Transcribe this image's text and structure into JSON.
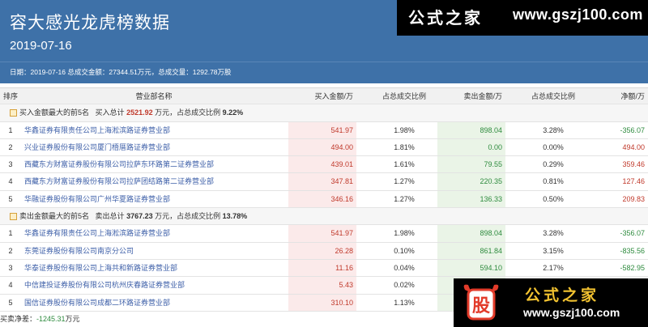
{
  "header": {
    "title": "容大感光龙虎榜数据",
    "date": "2019-07-16",
    "summary": "日期：2019-07-16 总成交金额：27344.51万元，总成交量：1292.78万股"
  },
  "logo": {
    "cn": "公式之家",
    "url": "www.gszj100.com"
  },
  "columns": [
    "排序",
    "营业部名称",
    "买入金额/万",
    "占总成交比例",
    "卖出金额/万",
    "占总成交比例",
    "净额/万"
  ],
  "buy_section": {
    "prefix": "买入金额最大的前5名",
    "total_label": "买入总计",
    "total": "2521.92",
    "unit_text": "万元，占总成交比例",
    "ratio": "9.22%",
    "rows": [
      {
        "rank": "1",
        "name": "华鑫证券有限责任公司上海淞滨路证券营业部",
        "buy": "541.97",
        "buy_pct": "1.98%",
        "sell": "898.04",
        "sell_pct": "3.28%",
        "net": "-356.07",
        "net_sign": "neg"
      },
      {
        "rank": "2",
        "name": "兴业证券股份有限公司厦门梧厝路证券营业部",
        "buy": "494.00",
        "buy_pct": "1.81%",
        "sell": "0.00",
        "sell_pct": "0.00%",
        "net": "494.00",
        "net_sign": "pos"
      },
      {
        "rank": "3",
        "name": "西藏东方财富证券股份有限公司拉萨东环路第二证券营业部",
        "buy": "439.01",
        "buy_pct": "1.61%",
        "sell": "79.55",
        "sell_pct": "0.29%",
        "net": "359.46",
        "net_sign": "pos"
      },
      {
        "rank": "4",
        "name": "西藏东方财富证券股份有限公司拉萨团结路第二证券营业部",
        "buy": "347.81",
        "buy_pct": "1.27%",
        "sell": "220.35",
        "sell_pct": "0.81%",
        "net": "127.46",
        "net_sign": "pos"
      },
      {
        "rank": "5",
        "name": "华融证券股份有限公司广州华夏路证券营业部",
        "buy": "346.16",
        "buy_pct": "1.27%",
        "sell": "136.33",
        "sell_pct": "0.50%",
        "net": "209.83",
        "net_sign": "pos"
      }
    ]
  },
  "sell_section": {
    "prefix": "卖出金额最大的前5名",
    "total_label": "卖出总计",
    "total": "3767.23",
    "unit_text": "万元，占总成交比例",
    "ratio": "13.78%",
    "rows": [
      {
        "rank": "1",
        "name": "华鑫证券有限责任公司上海淞滨路证券营业部",
        "buy": "541.97",
        "buy_pct": "1.98%",
        "sell": "898.04",
        "sell_pct": "3.28%",
        "net": "-356.07",
        "net_sign": "neg"
      },
      {
        "rank": "2",
        "name": "东莞证券股份有限公司南京分公司",
        "buy": "26.28",
        "buy_pct": "0.10%",
        "sell": "861.84",
        "sell_pct": "3.15%",
        "net": "-835.56",
        "net_sign": "neg"
      },
      {
        "rank": "3",
        "name": "华泰证券股份有限公司上海共和新路证券营业部",
        "buy": "11.16",
        "buy_pct": "0.04%",
        "sell": "594.10",
        "sell_pct": "2.17%",
        "net": "-582.95",
        "net_sign": "neg"
      },
      {
        "rank": "4",
        "name": "中信建投证券股份有限公司杭州庆春路证券营业部",
        "buy": "5.43",
        "buy_pct": "0.02%",
        "sell": "",
        "sell_pct": "",
        "net": "",
        "net_sign": "neg"
      },
      {
        "rank": "5",
        "name": "国信证券股份有限公司成都二环路证券营业部",
        "buy": "310.10",
        "buy_pct": "1.13%",
        "sell": "",
        "sell_pct": "",
        "net": "",
        "net_sign": "neg"
      }
    ]
  },
  "footer": {
    "label": "买卖净差：",
    "value": "-1245.31",
    "unit": "万元"
  },
  "watermark": {
    "badge": "股",
    "cn": "公式之家",
    "url": "www.gszj100.com"
  },
  "colors": {
    "header_bg": "#3e71a8",
    "buy_red": "#c0392b",
    "sell_green": "#2e8b3e"
  }
}
